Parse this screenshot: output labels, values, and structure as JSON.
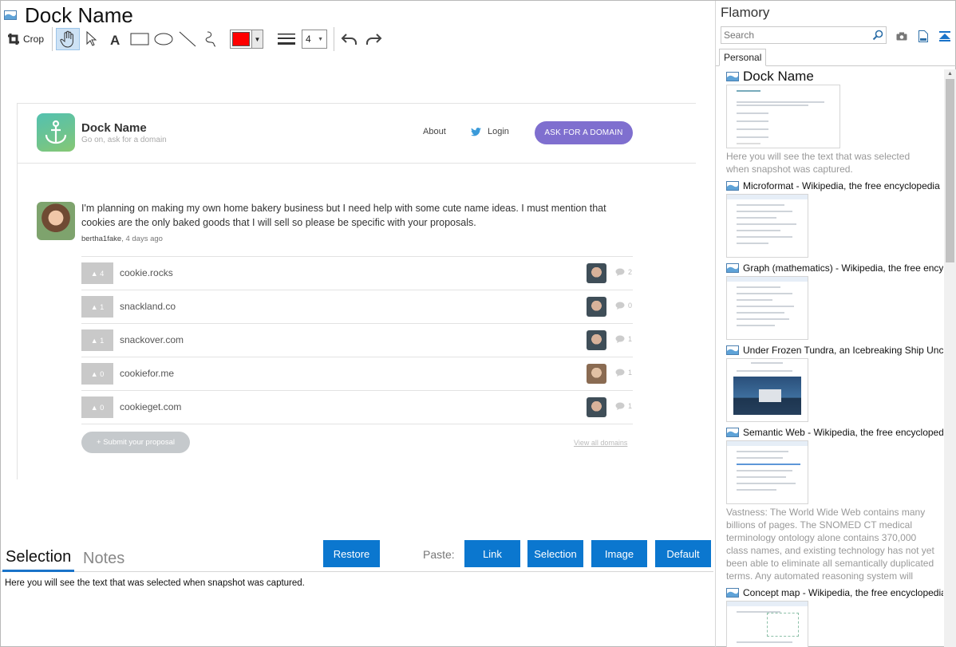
{
  "window": {
    "title": "Dock Name"
  },
  "toolbar": {
    "crop_label": "Crop",
    "line_width": "4",
    "color": "#ff0000"
  },
  "snapshot": {
    "brand": {
      "name": "Dock Name",
      "tagline": "Go on, ask for a domain"
    },
    "nav": {
      "about": "About",
      "login": "Login",
      "ask": "ASK FOR A DOMAIN"
    },
    "post": {
      "text": "I'm planning on making my own home bakery business but I need help with some cute name ideas. I must mention that cookies are the only baked goods that I will sell so please be specific with your proposals.",
      "author": "bertha1fake",
      "age": ", 4 days ago"
    },
    "domains": [
      {
        "votes": "▲ 4",
        "name": "cookie.rocks",
        "comments": "2"
      },
      {
        "votes": "▲ 1",
        "name": "snackland.co",
        "comments": "0"
      },
      {
        "votes": "▲ 1",
        "name": "snackover.com",
        "comments": "1"
      },
      {
        "votes": "▲ 0",
        "name": "cookiefor.me",
        "comments": "1"
      },
      {
        "votes": "▲ 0",
        "name": "cookieget.com",
        "comments": "1"
      }
    ],
    "submit": "+ Submit your proposal",
    "view_all": "View all domains"
  },
  "bottom": {
    "tab_selection": "Selection",
    "tab_notes": "Notes",
    "restore": "Restore",
    "paste_label": "Paste:",
    "paste_link": "Link",
    "paste_selection": "Selection",
    "paste_image": "Image",
    "paste_default": "Default",
    "selection_text": "Here you will see the text that was selected when snapshot was captured."
  },
  "sidebar": {
    "app_name": "Flamory",
    "search_placeholder": "Search",
    "tab_personal": "Personal",
    "entries": [
      {
        "title": "Dock Name",
        "desc": "Here you will see the text that was selected when snapshot was captured."
      },
      {
        "title": "Microformat - Wikipedia, the free encyclopedia",
        "desc": ""
      },
      {
        "title": "Graph (mathematics) - Wikipedia, the free encyclopedia",
        "desc": ""
      },
      {
        "title": "Under Frozen Tundra, an Icebreaking Ship Uncovers",
        "desc": ""
      },
      {
        "title": "Semantic Web - Wikipedia, the free encyclopedia",
        "desc": "Vastness: The World Wide Web contains many billions of pages. The SNOMED CT medical terminology ontology alone contains 370,000 class names, and existing technology has not yet been able to eliminate all semantically duplicated terms. Any automated reasoning system will have to deal with truly huge inputs."
      },
      {
        "title": "Concept map - Wikipedia, the free encyclopedia",
        "desc": ""
      }
    ]
  }
}
